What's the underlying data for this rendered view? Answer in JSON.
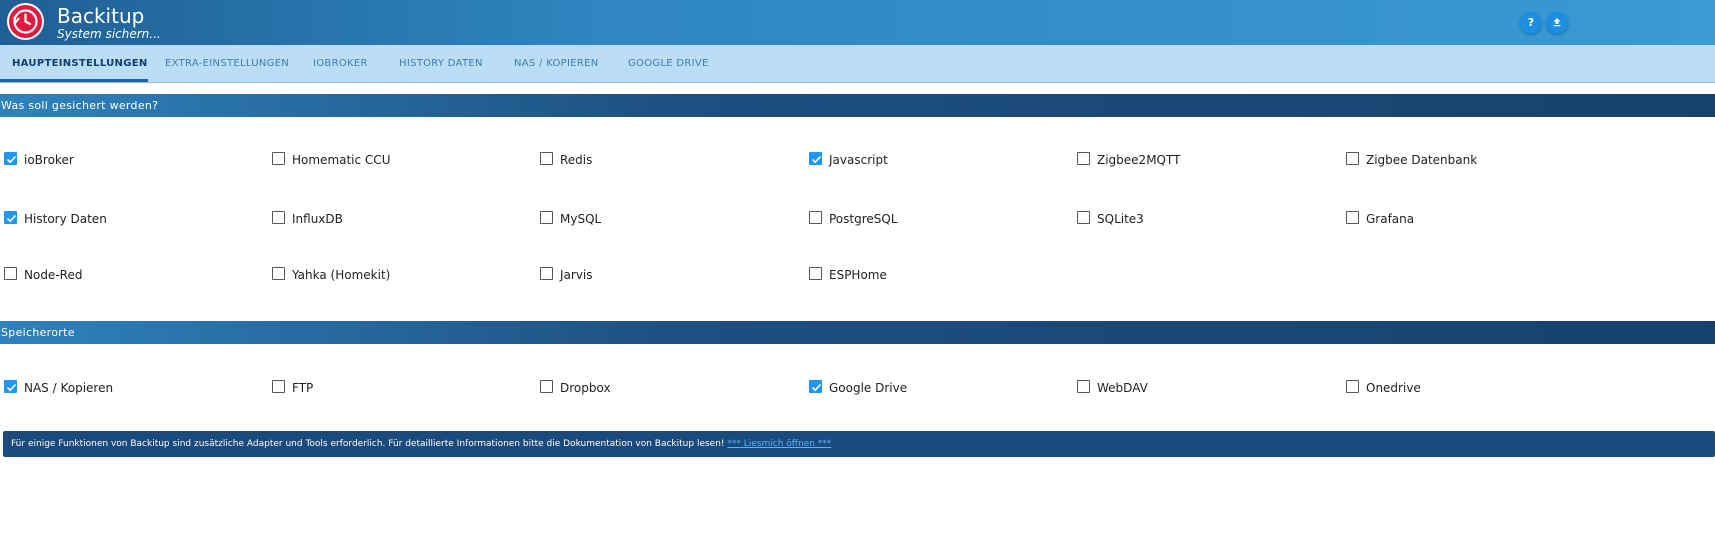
{
  "header": {
    "title": "Backitup",
    "subtitle": "System sichern...",
    "help_icon": "help-icon",
    "upload_icon": "upload-icon",
    "logo_color": "#e3193f"
  },
  "tabs": [
    {
      "label": "HAUPTEINSTELLUNGEN",
      "active": true
    },
    {
      "label": "EXTRA-EINSTELLUNGEN",
      "active": false
    },
    {
      "label": "IOBROKER",
      "active": false
    },
    {
      "label": "HISTORY DATEN",
      "active": false
    },
    {
      "label": "NAS / KOPIEREN",
      "active": false
    },
    {
      "label": "GOOGLE DRIVE",
      "active": false
    }
  ],
  "sections": {
    "backup": {
      "title": "Was soll gesichert werden?",
      "items": [
        {
          "label": "ioBroker",
          "checked": true
        },
        {
          "label": "Homematic CCU",
          "checked": false
        },
        {
          "label": "Redis",
          "checked": false
        },
        {
          "label": "Javascript",
          "checked": true
        },
        {
          "label": "Zigbee2MQTT",
          "checked": false
        },
        {
          "label": "Zigbee Datenbank",
          "checked": false
        },
        {
          "label": "History Daten",
          "checked": true
        },
        {
          "label": "InfluxDB",
          "checked": false
        },
        {
          "label": "MySQL",
          "checked": false
        },
        {
          "label": "PostgreSQL",
          "checked": false
        },
        {
          "label": "SQLite3",
          "checked": false
        },
        {
          "label": "Grafana",
          "checked": false
        },
        {
          "label": "Node-Red",
          "checked": false
        },
        {
          "label": "Yahka (Homekit)",
          "checked": false
        },
        {
          "label": "Jarvis",
          "checked": false
        },
        {
          "label": "ESPHome",
          "checked": false
        }
      ]
    },
    "storage": {
      "title": "Speicherorte",
      "items": [
        {
          "label": "NAS / Kopieren",
          "checked": true
        },
        {
          "label": "FTP",
          "checked": false
        },
        {
          "label": "Dropbox",
          "checked": false
        },
        {
          "label": "Google Drive",
          "checked": true
        },
        {
          "label": "WebDAV",
          "checked": false
        },
        {
          "label": "Onedrive",
          "checked": false
        }
      ]
    }
  },
  "notice": {
    "text": "Für einige Funktionen von Backitup sind zusätzliche Adapter und Tools erforderlich. Für detaillierte Informationen bitte die Dokumentation von Backitup lesen! ",
    "link_label": "*** Liesmich öffnen ***"
  }
}
